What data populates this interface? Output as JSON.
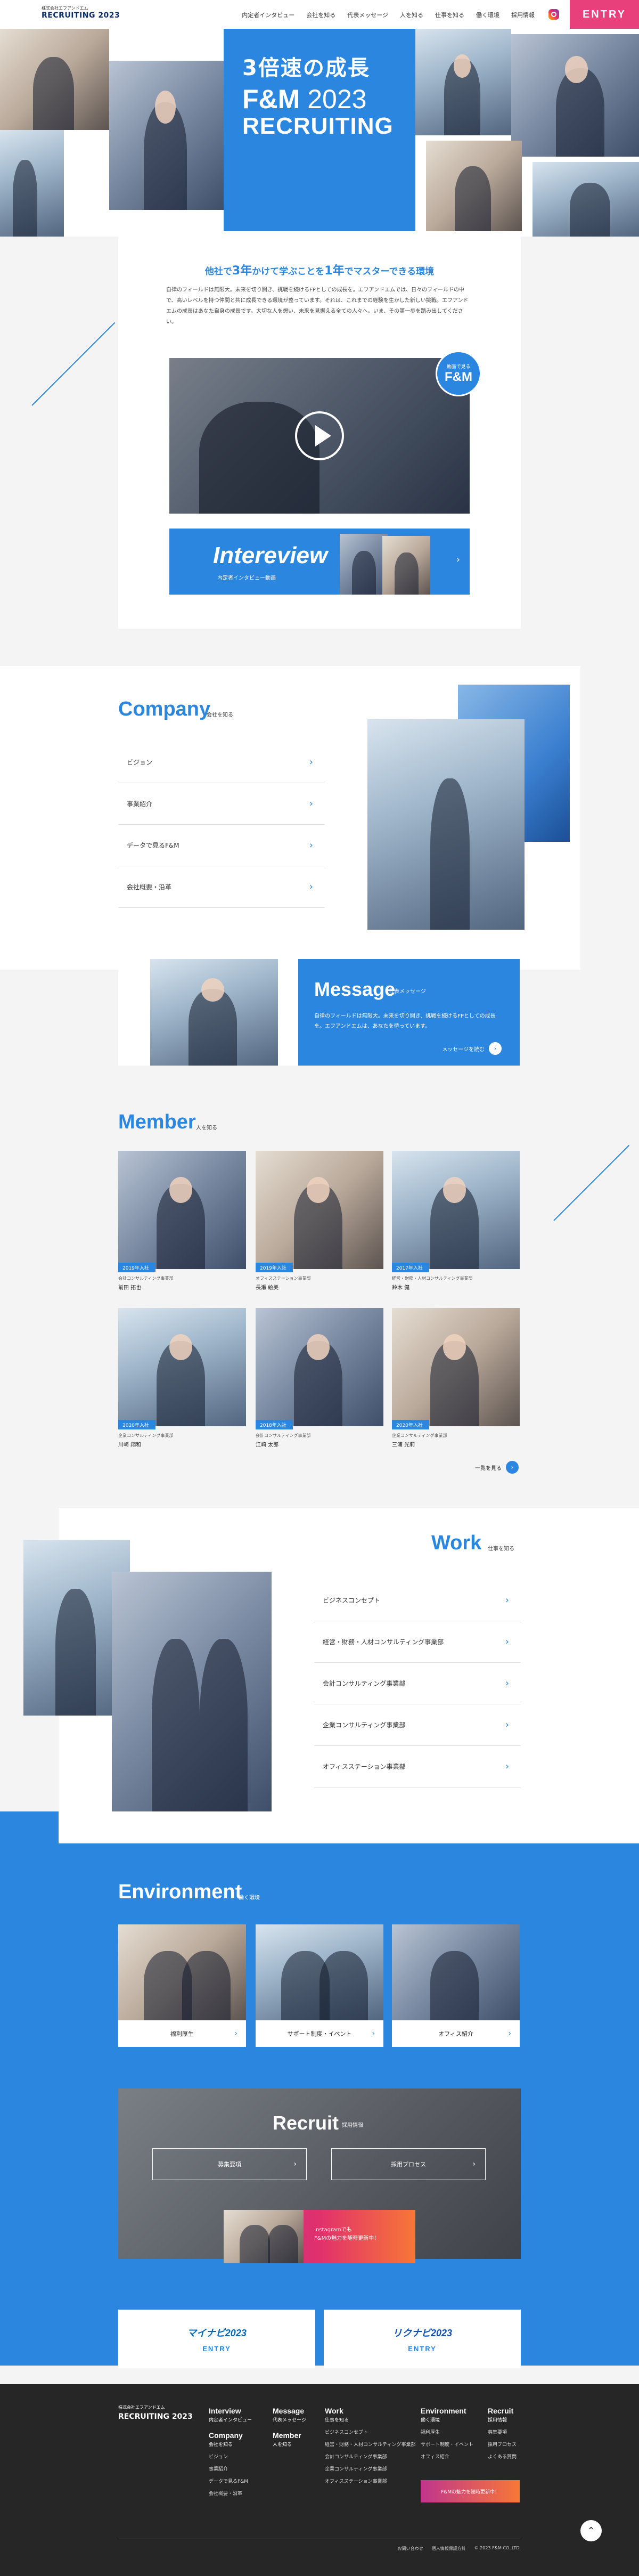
{
  "header": {
    "corp": "株式会社エフアンドエム",
    "logo": "RECRUITING 2023",
    "nav": [
      "内定者インタビュー",
      "会社を知る",
      "代表メッセージ",
      "人を知る",
      "仕事を知る",
      "働く環境",
      "採用情報"
    ],
    "entry": "ENTRY"
  },
  "hero": {
    "line1": "3倍速の成長",
    "line2": "F&M",
    "year": "2023",
    "line3": "RECRUITING"
  },
  "intro": {
    "title_pre": "他社で",
    "title_num1": "3年",
    "title_mid": "かけて学ぶことを",
    "title_num2": "1年",
    "title_post": "でマスターできる環境",
    "text": "自律のフィールドは無限大。未来を切り開き、挑戦を続けるFPとしての成長を。エフアンドエムでは、日々のフィールドの中で、高いレベルを持つ仲間と共に成長できる環境が整っています。それは、これまでの経験を生かした新しい挑戦。エフアンドエムの成長はあなた自身の成長です。大切な人を想い、未来を見据える全ての人々へ。いま、その第一歩を踏み出してください。",
    "badge_small": "動画で見る",
    "badge_big": "F&M",
    "interview_title": "Intereview",
    "interview_sub": "内定者インタビュー動画"
  },
  "company": {
    "title": "Company",
    "sub": "会社を知る",
    "items": [
      "ビジョン",
      "事業紹介",
      "データで見るF&M",
      "会社概要・沿革"
    ]
  },
  "message": {
    "title": "Message",
    "sub": "代表メッセージ",
    "text": "自律のフィールドは無限大。未来を切り開き、挑戦を続けるFPとしての成長を。エフアンドエムは、あなたを待っています。",
    "more": "メッセージを読む"
  },
  "member": {
    "title": "Member",
    "sub": "人を知る",
    "cards": [
      {
        "year": "2019年入社",
        "dept": "会計コンサルティング事業部",
        "name": "前田 拓也"
      },
      {
        "year": "2019年入社",
        "dept": "オフィスステーション事業部",
        "name": "長瀬 絵美"
      },
      {
        "year": "2017年入社",
        "dept": "経営・財務・人材コンサルティング事業部",
        "name": "鈴木 健"
      },
      {
        "year": "2020年入社",
        "dept": "企業コンサルティング事業部",
        "name": "川﨑 翔和"
      },
      {
        "year": "2018年入社",
        "dept": "会計コンサルティング事業部",
        "name": "江崎 太郎"
      },
      {
        "year": "2020年入社",
        "dept": "企業コンサルティング事業部",
        "name": "三浦 光莉"
      }
    ],
    "view_all": "一覧を見る"
  },
  "work": {
    "title": "Work",
    "sub": "仕事を知る",
    "items": [
      "ビジネスコンセプト",
      "経営・財務・人材コンサルティング事業部",
      "会計コンサルティング事業部",
      "企業コンサルティング事業部",
      "オフィスステーション事業部"
    ]
  },
  "environment": {
    "title": "Environment",
    "sub": "働く環境",
    "items": [
      "福利厚生",
      "サポート制度・イベント",
      "オフィス紹介"
    ]
  },
  "recruit": {
    "title": "Recruit",
    "sub": "採用情報",
    "buttons": [
      "募集要項",
      "採用プロセス"
    ],
    "instagram_line1": "Instagramでも",
    "instagram_line2": "F&Mの魅力を随時更新中！"
  },
  "entries": [
    {
      "brand": "マイナビ2023",
      "label": "ENTRY"
    },
    {
      "brand": "リクナビ2023",
      "label": "ENTRY"
    }
  ],
  "footer": {
    "corp": "株式会社エフアンドエム",
    "logo": "RECRUITING 2023",
    "cols": [
      {
        "h": "Interview",
        "hs": "内定者インタビュー",
        "items": []
      },
      {
        "h": "Company",
        "hs": "会社を知る",
        "items": [
          "ビジョン",
          "事業紹介",
          "データで見るF&M",
          "会社概要・沿革"
        ]
      },
      {
        "h": "Message",
        "hs": "代表メッセージ",
        "items": []
      },
      {
        "h": "Member",
        "hs": "人を知る",
        "items": []
      },
      {
        "h": "Work",
        "hs": "仕事を知る",
        "items": [
          "ビジネスコンセプト",
          "経営・財務・人材コンサルティング事業部",
          "会計コンサルティング事業部",
          "企業コンサルティング事業部",
          "オフィスステーション事業部"
        ]
      },
      {
        "h": "Environment",
        "hs": "働く環境",
        "items": [
          "福利厚生",
          "サポート制度・イベント",
          "オフィス紹介"
        ]
      },
      {
        "h": "Recruit",
        "hs": "採用情報",
        "items": [
          "募集要項",
          "採用プロセス",
          "よくある質問"
        ]
      }
    ],
    "ig": "F&Mの魅力を随時更新中！",
    "bottom": [
      "お問い合わせ",
      "個人情報保護方針"
    ],
    "copyright": "© 2023 F&M CO.,LTD."
  },
  "colors": {
    "accent": "#2b86e0",
    "entry": "#e8407a",
    "footer": "#262626"
  }
}
